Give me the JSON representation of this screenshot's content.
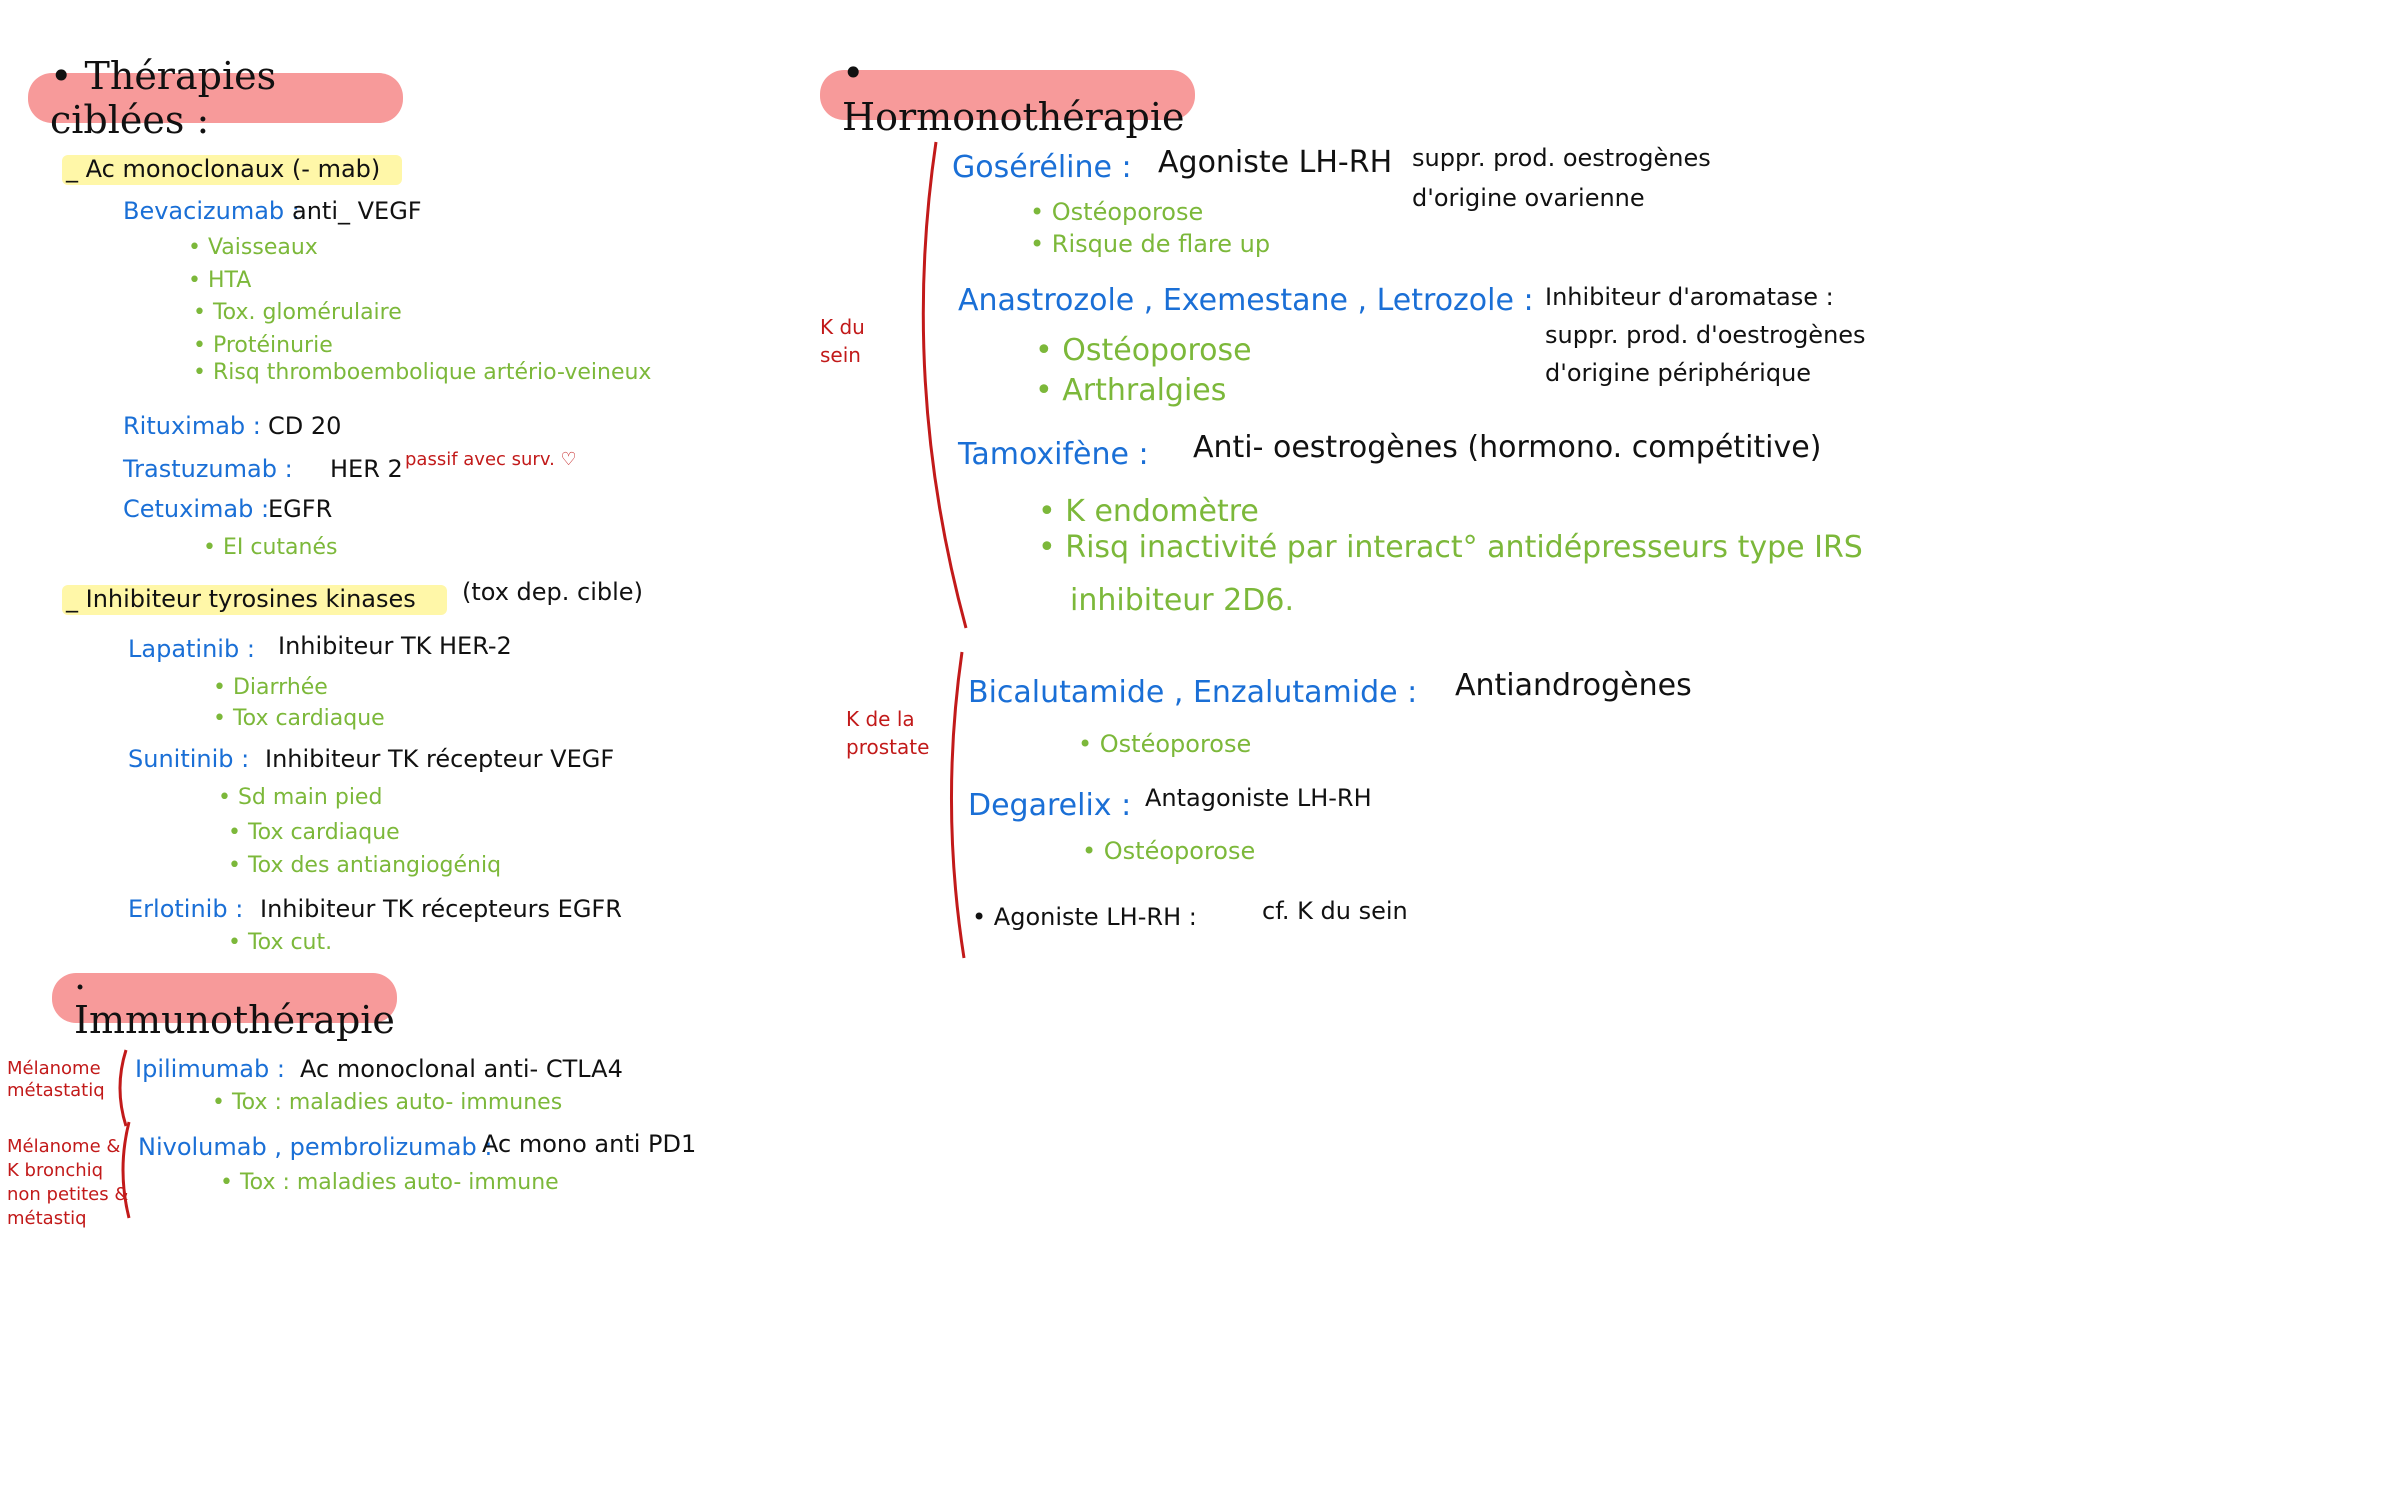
{
  "left": {
    "header": "• Thérapies ciblées :",
    "monoclonal": {
      "title": "_ Ac monoclonaux (- mab)",
      "drugs": [
        {
          "name": "Bevacizumab :",
          "desc": "anti_ VEGF",
          "effects": [
            "• Vaisseaux",
            "• HTA",
            "• Tox. glomérulaire",
            "• Protéinurie",
            "• Risq thromboembolique artério-veineux"
          ]
        },
        {
          "name": "Rituximab :",
          "desc": "CD 20",
          "effects": []
        },
        {
          "name": "Trastuzumab :",
          "desc": "HER 2",
          "effects": []
        },
        {
          "name": "Cetuximab :",
          "desc": "EGFR",
          "effects": [
            "• EI cutanés"
          ]
        }
      ],
      "trastuzumab_note": "passif avec surv. ♡"
    },
    "tki": {
      "title": "_ Inhibiteur tyrosines kinases",
      "paren": "(tox dep. cible)",
      "drugs": [
        {
          "name": "Lapatinib :",
          "desc": "Inhibiteur TK HER-2",
          "effects": [
            "• Diarrhée",
            "• Tox cardiaque"
          ]
        },
        {
          "name": "Sunitinib :",
          "desc": "Inhibiteur TK récepteur VEGF",
          "effects": [
            "• Sd main pied",
            "• Tox cardiaque",
            "• Tox des antiangiogéniq"
          ]
        },
        {
          "name": "Erlotinib :",
          "desc": "Inhibiteur TK récepteurs EGFR",
          "effects": [
            "• Tox cut."
          ]
        }
      ]
    }
  },
  "immuno": {
    "header": ". Immunothérapie",
    "rows": [
      {
        "indication": [
          "Mélanome",
          "métastatiq"
        ],
        "name": "Ipilimumab :",
        "desc": "Ac monoclonal anti- CTLA4",
        "effect": "• Tox : maladies auto- immunes"
      },
      {
        "indication": [
          "Mélanome &",
          "K bronchiq",
          "non petites &",
          "métastiq"
        ],
        "name": "Nivolumab , pembrolizumab :",
        "desc": "Ac mono anti PD1",
        "effect": "• Tox : maladies auto- immune"
      }
    ]
  },
  "hormono": {
    "header": "• Hormonothérapie",
    "sein": {
      "label": [
        "K du",
        "sein"
      ],
      "items": [
        {
          "name": "Goséréline :",
          "desc": "Agoniste LH-RH",
          "note": [
            "suppr. prod. oestrogènes",
            "d'origine ovarienne"
          ],
          "effects": [
            "• Ostéoporose",
            "• Risque de flare up"
          ]
        },
        {
          "name": "Anastrozole , Exemestane , Letrozole :",
          "desc": "",
          "note": [
            "Inhibiteur d'aromatase :",
            "suppr. prod. d'oestrogènes",
            "d'origine périphérique"
          ],
          "effects": [
            "• Ostéoporose",
            "• Arthralgies"
          ]
        },
        {
          "name": "Tamoxifène :",
          "desc": "Anti- oestrogènes (hormono. compétitive)",
          "note": [],
          "effects": [
            "• K endomètre",
            "• Risq inactivité par interact° antidépresseurs type IRS",
            "inhibiteur 2D6."
          ]
        }
      ]
    },
    "prostate": {
      "label": [
        "K de la",
        "prostate"
      ],
      "items": [
        {
          "name": "Bicalutamide , Enzalutamide :",
          "desc": "Antiandrogènes",
          "effects": [
            "• Ostéoporose"
          ]
        },
        {
          "name": "Degarelix :",
          "desc": "Antagoniste LH-RH",
          "effects": [
            "• Ostéoporose"
          ]
        },
        {
          "name": "• Agoniste LH-RH :",
          "desc": "cf. K du sein",
          "effects": []
        }
      ]
    }
  },
  "colors": {
    "header_bg": "#f79a9a",
    "highlight": "#fff7a8",
    "drug": "#1a6fd6",
    "effect": "#7cb83a",
    "indication": "#c21a1a"
  }
}
